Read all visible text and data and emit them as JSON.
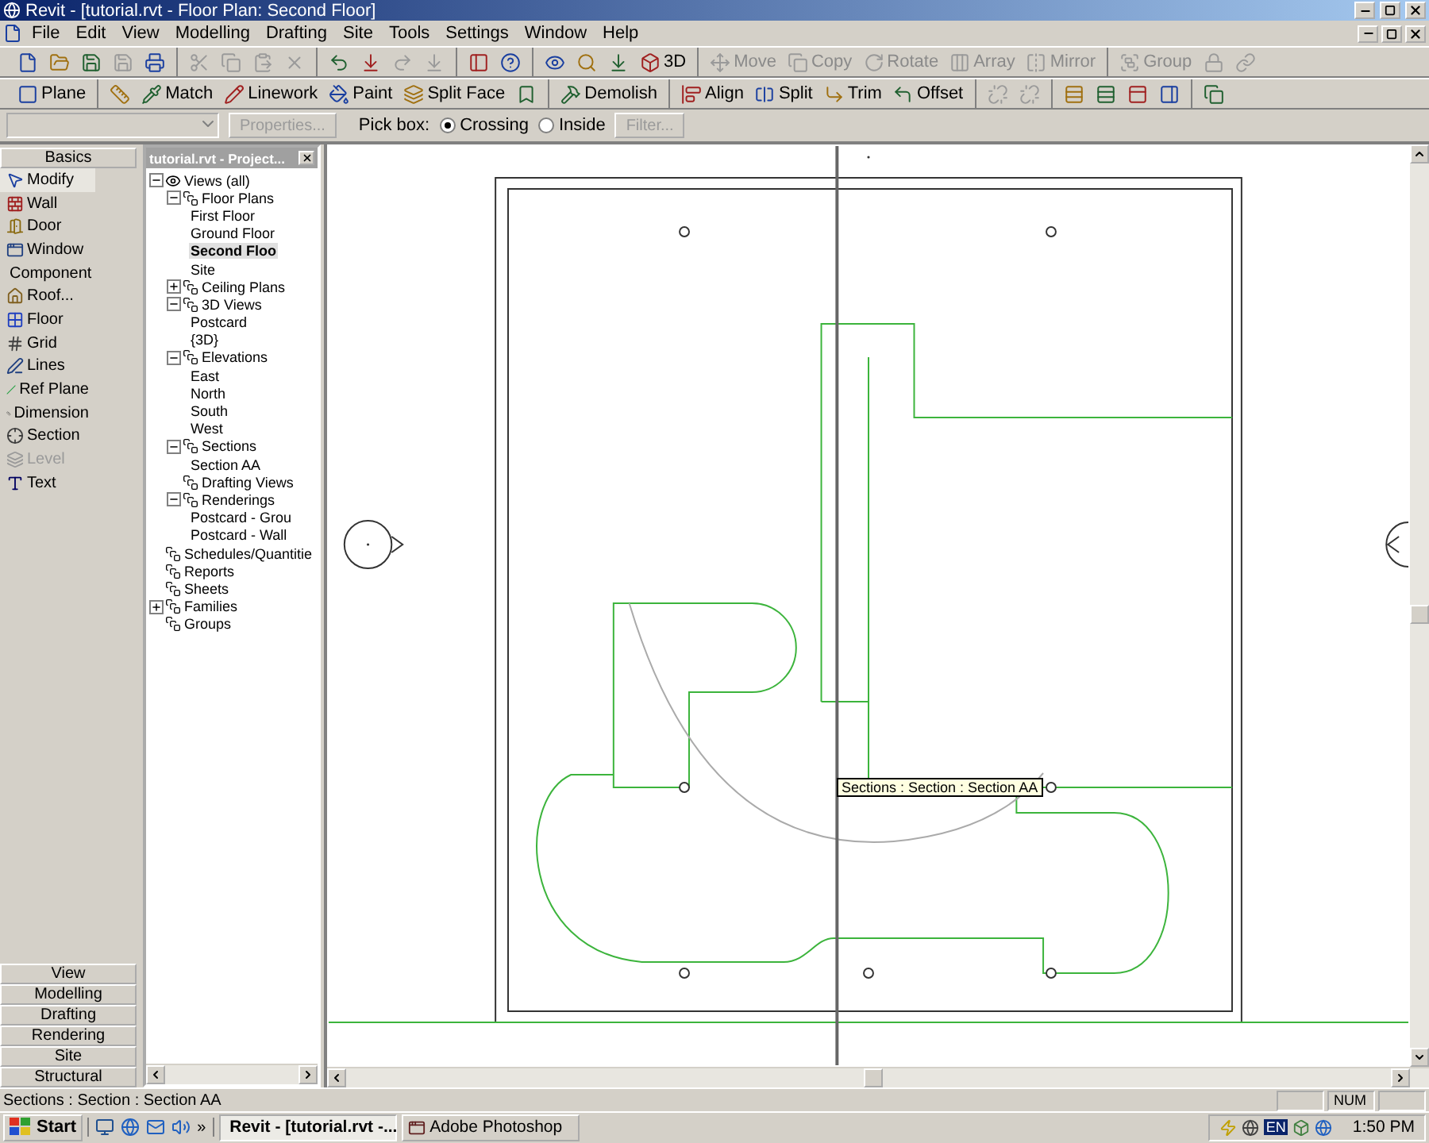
{
  "window": {
    "title": "Revit - [tutorial.rvt - Floor Plan: Second Floor]"
  },
  "menu": [
    "File",
    "Edit",
    "View",
    "Modelling",
    "Drafting",
    "Site",
    "Tools",
    "Settings",
    "Window",
    "Help"
  ],
  "toolbar_top": [
    [
      {
        "disabled": false
      },
      {
        "disabled": false
      },
      {
        "disabled": false
      },
      {
        "disabled": true
      },
      {
        "disabled": false
      }
    ],
    [
      {
        "disabled": true
      },
      {
        "disabled": true
      },
      {
        "disabled": true
      },
      {
        "disabled": true
      }
    ],
    [
      {
        "disabled": false
      },
      {
        "disabled": false
      },
      {
        "disabled": true
      },
      {
        "disabled": true
      }
    ],
    [
      {
        "disabled": false
      },
      {
        "disabled": false
      }
    ],
    [
      {
        "disabled": false
      },
      {
        "disabled": false
      },
      {
        "disabled": false
      },
      {
        "label": "3D",
        "disabled": false
      }
    ],
    [
      {
        "label": "Move",
        "disabled": true
      },
      {
        "label": "Copy",
        "disabled": true
      },
      {
        "label": "Rotate",
        "disabled": true
      },
      {
        "label": "Array",
        "disabled": true
      },
      {
        "label": "Mirror",
        "disabled": true
      }
    ],
    [
      {
        "label": "Group",
        "disabled": true
      },
      {
        "disabled": true
      },
      {
        "disabled": true
      }
    ]
  ],
  "toolbar_edit": [
    [
      {
        "label": "Plane",
        "disabled": false
      }
    ],
    [
      {
        "disabled": false
      },
      {
        "label": "Match",
        "disabled": false
      },
      {
        "label": "Linework",
        "disabled": false
      },
      {
        "label": "Paint",
        "disabled": false
      },
      {
        "label": "Split Face",
        "disabled": false
      },
      {
        "disabled": false
      }
    ],
    [
      {
        "label": "Demolish",
        "disabled": false
      }
    ],
    [
      {
        "label": "Align",
        "disabled": false
      },
      {
        "label": "Split",
        "disabled": false
      },
      {
        "label": "Trim",
        "disabled": false
      },
      {
        "label": "Offset",
        "disabled": false
      }
    ],
    [
      {
        "disabled": true
      },
      {
        "disabled": true
      }
    ],
    [
      {
        "disabled": false
      },
      {
        "disabled": false
      },
      {
        "disabled": false
      },
      {
        "disabled": false
      }
    ],
    [
      {
        "disabled": false
      }
    ]
  ],
  "options_bar": {
    "type_selector": {
      "disabled": true
    },
    "properties": {
      "label": "Properties...",
      "disabled": true
    },
    "pick_box_label": "Pick box:",
    "pick_box": [
      {
        "label": "Crossing",
        "selected": true
      },
      {
        "label": "Inside",
        "selected": false
      }
    ],
    "filter": {
      "label": "Filter...",
      "disabled": true
    }
  },
  "design_bar": {
    "tab": "Basics",
    "items": [
      {
        "label": "Modify",
        "selected": true,
        "disabled": false
      },
      {
        "label": "Wall",
        "selected": false,
        "disabled": false
      },
      {
        "label": "Door",
        "selected": false,
        "disabled": false
      },
      {
        "label": "Window",
        "selected": false,
        "disabled": false
      },
      {
        "label": "Component",
        "selected": false,
        "disabled": false
      },
      {
        "label": "Roof...",
        "selected": false,
        "disabled": false
      },
      {
        "label": "Floor",
        "selected": false,
        "disabled": false
      },
      {
        "label": "Grid",
        "selected": false,
        "disabled": false
      },
      {
        "label": "Lines",
        "selected": false,
        "disabled": false
      },
      {
        "label": "Ref Plane",
        "selected": false,
        "disabled": false
      },
      {
        "label": "Dimension",
        "selected": false,
        "disabled": false
      },
      {
        "label": "Section",
        "selected": false,
        "disabled": false
      },
      {
        "label": "Level",
        "selected": false,
        "disabled": true
      },
      {
        "label": "Text",
        "selected": false,
        "disabled": false
      }
    ],
    "tabs": [
      "View",
      "Modelling",
      "Drafting",
      "Rendering",
      "Site",
      "Structural"
    ]
  },
  "project_browser": {
    "title": "tutorial.rvt - Project...",
    "tree": [
      {
        "label": "Views (all)",
        "kind": "folder",
        "expanded": true,
        "selected": false,
        "children": [
          {
            "label": "Floor Plans",
            "kind": "folder",
            "expanded": true,
            "selected": false,
            "children": [
              {
                "label": "First Floor",
                "kind": "view",
                "selected": false
              },
              {
                "label": "Ground Floor",
                "kind": "view",
                "selected": false
              },
              {
                "label": "Second Floo",
                "kind": "view",
                "selected": true
              },
              {
                "label": "Site",
                "kind": "view",
                "selected": false
              }
            ]
          },
          {
            "label": "Ceiling Plans",
            "kind": "folder",
            "expanded": false,
            "selected": false
          },
          {
            "label": "3D Views",
            "kind": "folder",
            "expanded": true,
            "selected": false,
            "children": [
              {
                "label": "Postcard",
                "kind": "view",
                "selected": false
              },
              {
                "label": "{3D}",
                "kind": "view",
                "selected": false
              }
            ]
          },
          {
            "label": "Elevations",
            "kind": "folder",
            "expanded": true,
            "selected": false,
            "children": [
              {
                "label": "East",
                "kind": "view",
                "selected": false
              },
              {
                "label": "North",
                "kind": "view",
                "selected": false
              },
              {
                "label": "South",
                "kind": "view",
                "selected": false
              },
              {
                "label": "West",
                "kind": "view",
                "selected": false
              }
            ]
          },
          {
            "label": "Sections",
            "kind": "folder",
            "expanded": true,
            "selected": false,
            "children": [
              {
                "label": "Section AA",
                "kind": "view",
                "selected": false
              }
            ]
          },
          {
            "label": "Drafting Views",
            "kind": "folder",
            "selected": false
          },
          {
            "label": "Renderings",
            "kind": "folder",
            "expanded": true,
            "selected": false,
            "children": [
              {
                "label": "Postcard - Grou",
                "kind": "view",
                "selected": false
              },
              {
                "label": "Postcard - Wall",
                "kind": "view",
                "selected": false
              }
            ]
          }
        ]
      },
      {
        "label": "Schedules/Quantitie",
        "kind": "folder",
        "selected": false
      },
      {
        "label": "Reports",
        "kind": "folder",
        "selected": false
      },
      {
        "label": "Sheets",
        "kind": "folder",
        "selected": false
      },
      {
        "label": "Families",
        "kind": "folder",
        "expanded": false,
        "selected": false
      },
      {
        "label": "Groups",
        "kind": "folder",
        "selected": false
      }
    ]
  },
  "canvas": {
    "tooltip": "Sections : Section : Section AA"
  },
  "status_bar": {
    "message": "Sections : Section : Section AA",
    "indicator": "NUM"
  },
  "taskbar": {
    "start": "Start",
    "more": "»",
    "tasks": [
      {
        "label": "Revit - [tutorial.rvt -...",
        "selected": true
      },
      {
        "label": "Adobe Photoshop",
        "selected": false
      }
    ],
    "language": "EN",
    "clock": "1:50 PM"
  }
}
